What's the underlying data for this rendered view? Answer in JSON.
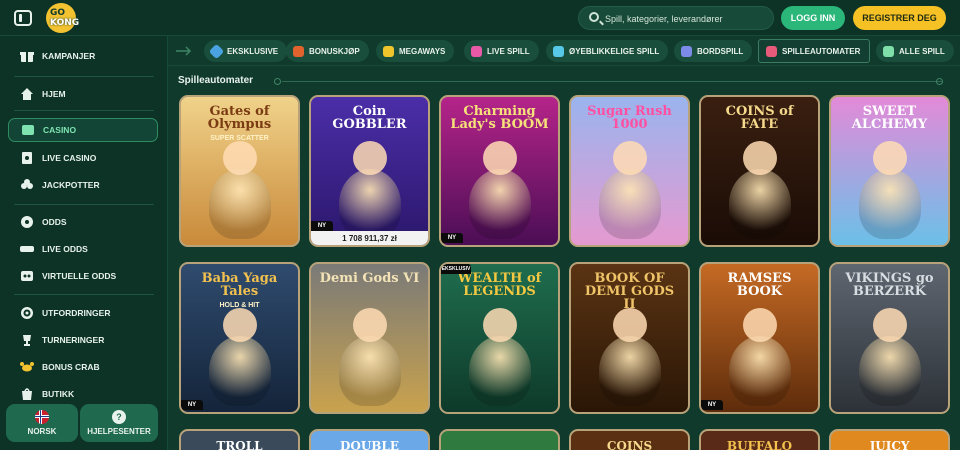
{
  "topbar": {
    "logo_line1": "GO",
    "logo_line2": "KONG",
    "search_placeholder": "Spill, kategorier, leverandører",
    "login_label": "LOGG INN",
    "register_label": "REGISTRER DEG"
  },
  "sidebar": {
    "items": [
      {
        "label": "KAMPANJER",
        "icon": "gift-icon"
      },
      {
        "label": "HJEM",
        "icon": "home-icon"
      },
      {
        "label": "CASINO",
        "icon": "casino-icon",
        "active": true
      },
      {
        "label": "LIVE CASINO",
        "icon": "live-casino-icon"
      },
      {
        "label": "JACKPOTTER",
        "icon": "clover-icon"
      },
      {
        "label": "ODDS",
        "icon": "football-icon"
      },
      {
        "label": "LIVE ODDS",
        "icon": "live-odds-icon"
      },
      {
        "label": "VIRTUELLE ODDS",
        "icon": "virtual-odds-icon"
      },
      {
        "label": "UTFORDRINGER",
        "icon": "target-icon"
      },
      {
        "label": "TURNERINGER",
        "icon": "tournament-icon"
      },
      {
        "label": "BONUS CRAB",
        "icon": "crab-icon"
      },
      {
        "label": "BUTIKK",
        "icon": "shop-icon"
      }
    ],
    "language_label": "NORSK",
    "help_label": "HJELPESENTER"
  },
  "categories": [
    {
      "label": "EKSKLUSIVE",
      "color": "#4aa3e0"
    },
    {
      "label": "BONUSKJØP",
      "color": "#e0622d"
    },
    {
      "label": "MEGAWAYS",
      "color": "#f0c52c"
    },
    {
      "label": "LIVE SPILL",
      "color": "#e85aa8"
    },
    {
      "label": "ØYEBLIKKELIGE SPILL",
      "color": "#58c8e8"
    },
    {
      "label": "BORDSPILL",
      "color": "#7c8be8"
    },
    {
      "label": "SPILLEAUTOMATER",
      "color": "#e85a7a",
      "active": true
    },
    {
      "label": "ALLE SPILL",
      "color": "#7ee0a8"
    }
  ],
  "section": {
    "title": "Spilleautomater"
  },
  "games_row1": [
    {
      "title": "Gates of Olympus",
      "subtitle": "SUPER SCATTER",
      "bg1": "#f0d28a",
      "bg2": "#c98a3a",
      "text": "#7a3b12",
      "badge": ""
    },
    {
      "title": "Coin GOBBLER",
      "subtitle": "",
      "bg1": "#4b2ea8",
      "bg2": "#2b176b",
      "text": "#ffffff",
      "badge": "NY",
      "jackpot": "1 708 911,37 zł"
    },
    {
      "title": "Charming Lady's BOOM",
      "subtitle": "",
      "bg1": "#b5248a",
      "bg2": "#4b0e55",
      "text": "#f7e27a",
      "badge": "NY"
    },
    {
      "title": "Sugar Rush 1000",
      "subtitle": "",
      "bg1": "#9ab4ee",
      "bg2": "#e59ad0",
      "text": "#ff4fa0",
      "badge": ""
    },
    {
      "title": "COINS of FATE",
      "subtitle": "",
      "bg1": "#3a1f10",
      "bg2": "#1a0c06",
      "text": "#f5d98c",
      "badge": ""
    },
    {
      "title": "SWEET ALCHEMY",
      "subtitle": "",
      "bg1": "#e38ad8",
      "bg2": "#6bc0e8",
      "text": "#ffffff",
      "badge": ""
    }
  ],
  "games_row2": [
    {
      "title": "Baba Yaga Tales",
      "subtitle": "HOLD & HIT",
      "bg1": "#2f4b6e",
      "bg2": "#14243a",
      "text": "#f2c14e",
      "badge": "NY"
    },
    {
      "title": "Demi Gods VI",
      "subtitle": "",
      "bg1": "#7a7a78",
      "bg2": "#c9a24d",
      "text": "#f3e3b6",
      "badge": ""
    },
    {
      "title": "WEALTH of LEGENDS",
      "subtitle": "",
      "bg1": "#1f6d4e",
      "bg2": "#0e3a2a",
      "text": "#f5c842",
      "badge": "EKSKLUSIV"
    },
    {
      "title": "BOOK OF DEMI GODS II",
      "subtitle": "",
      "bg1": "#5a3413",
      "bg2": "#2a1606",
      "text": "#f0c469",
      "badge": ""
    },
    {
      "title": "RAMSES BOOK",
      "subtitle": "",
      "bg1": "#c56a24",
      "bg2": "#5e2c0b",
      "text": "#ffffff",
      "badge": "NY"
    },
    {
      "title": "VIKINGS go BERZERK",
      "subtitle": "",
      "bg1": "#5e6670",
      "bg2": "#2d3238",
      "text": "#d8dde2",
      "badge": ""
    }
  ],
  "games_row3": [
    {
      "title": "TROLL",
      "bg1": "#3a4a5a",
      "text": "#ffffff"
    },
    {
      "title": "DOUBLE",
      "bg1": "#6aa8e8",
      "text": "#ffffff"
    },
    {
      "title": "",
      "bg1": "#2f7a3e",
      "text": "#ffffff"
    },
    {
      "title": "COINS",
      "bg1": "#5a2f12",
      "text": "#f5d98c"
    },
    {
      "title": "BUFFALO",
      "bg1": "#5a2a18",
      "text": "#f2c14e"
    },
    {
      "title": "JUICY",
      "bg1": "#e0891f",
      "text": "#ffffff"
    }
  ]
}
